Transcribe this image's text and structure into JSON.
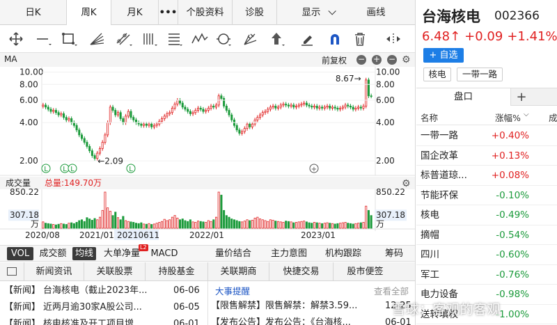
{
  "tabs": [
    {
      "label": "日K"
    },
    {
      "label": "周K"
    },
    {
      "label": "月K"
    },
    {
      "label": "•••"
    },
    {
      "label": "个股资料"
    },
    {
      "label": "诊股"
    },
    {
      "label": "显示"
    },
    {
      "label": "画线"
    }
  ],
  "ma_bar": {
    "label": "MA",
    "adjust": "前复权"
  },
  "volume_bar": {
    "label": "成交量",
    "total": "总量:149.70万"
  },
  "bottom_tabs": [
    "VOL",
    "成交额",
    "均线",
    "大单净量",
    "MACD",
    "量价结合",
    "主力意图",
    "机构跟踪",
    "筹码"
  ],
  "bottom_badge": "L2",
  "news_tabs": [
    "新闻资讯",
    "关联股票",
    "持股基金",
    "关联期商",
    "快捷交易",
    "股市便签"
  ],
  "news": [
    {
      "tag": "【新闻】",
      "title": "台海核电（截止2023年...",
      "date": "06-06"
    },
    {
      "tag": "【新闻】",
      "title": "近两月逾30家A股公司...",
      "date": "06-05"
    },
    {
      "tag": "【新闻】",
      "title": "核电核准及开工项目增...",
      "date": "06-01"
    }
  ],
  "events": {
    "title": "大事提醒",
    "more": "查看全部",
    "items": [
      {
        "tag": "【限售解禁】",
        "title": "限售解禁：解禁3.59...",
        "date": "12-25"
      },
      {
        "tag": "【发布公告】",
        "title": "发布公告：《台海核...",
        "date": "06-01"
      }
    ]
  },
  "stock": {
    "name": "台海核电",
    "code": "002366",
    "price": "6.48",
    "arrow": "↑",
    "change": "+0.09",
    "pct": "+1.41%",
    "add_button": "+ 自选",
    "tags": [
      "核电",
      "一带一路"
    ]
  },
  "panel": {
    "title": "盘口",
    "plus": "+",
    "col_name": "名称",
    "col_pct": "涨幅%",
    "col_extra": "成",
    "rows": [
      {
        "name": "一带一路",
        "pct": "+0.40%",
        "dir": "up"
      },
      {
        "name": "国企改革",
        "pct": "+0.13%",
        "dir": "up"
      },
      {
        "name": "标普道琼...",
        "pct": "+0.08%",
        "dir": "up"
      },
      {
        "name": "节能环保",
        "pct": "-0.10%",
        "dir": "down"
      },
      {
        "name": "核电",
        "pct": "-0.49%",
        "dir": "down"
      },
      {
        "name": "摘帽",
        "pct": "-0.54%",
        "dir": "down"
      },
      {
        "name": "四川",
        "pct": "-0.60%",
        "dir": "down"
      },
      {
        "name": "军工",
        "pct": "-0.76%",
        "dir": "down"
      },
      {
        "name": "电力设备",
        "pct": "-0.98%",
        "dir": "down"
      },
      {
        "name": "送转填权",
        "pct": "-1.00%",
        "dir": "down"
      }
    ]
  },
  "watermark": "雪球：客观的客观",
  "chart_data": {
    "type": "candlestick",
    "price_axis": {
      "scale": "log",
      "ticks_left": [
        "10.00",
        "8.00",
        "6.00",
        "4.00",
        "2.00"
      ],
      "ticks_right": [
        "10.00",
        "8.00",
        "6.00",
        "4.00",
        "2.00"
      ],
      "ylim": [
        1.7,
        10.2
      ]
    },
    "annotations": [
      {
        "label": "←2.09",
        "value": 2.09
      },
      {
        "label": "8.67→",
        "value": 8.67
      }
    ],
    "x_labels": [
      "2020/08",
      "2021/01",
      "20210611",
      "2022/01",
      "2023/01"
    ],
    "volume_axis": {
      "ticks_left": [
        "850.22",
        "307.18",
        "万"
      ],
      "ticks_right": [
        "850.22",
        "307.18",
        "万"
      ],
      "max": 850.22,
      "mid": 307.18
    },
    "markers": [
      "L",
      "L",
      "L",
      "L",
      "+"
    ],
    "weekly_close": [
      5.5,
      5.3,
      5.1,
      4.9,
      5.0,
      4.8,
      4.6,
      4.7,
      4.4,
      4.2,
      4.3,
      4.0,
      3.8,
      3.5,
      3.2,
      3.0,
      2.8,
      2.6,
      2.4,
      2.2,
      2.09,
      2.3,
      2.5,
      2.8,
      3.2,
      4.0,
      5.3,
      5.0,
      4.6,
      4.8,
      4.3,
      4.0,
      4.5,
      4.9,
      4.4,
      4.2,
      4.0,
      3.9,
      3.8,
      3.9,
      3.8,
      3.9,
      3.7,
      3.8,
      3.9,
      4.1,
      4.3,
      4.5,
      4.7,
      4.8,
      5.2,
      5.6,
      6.0,
      5.7,
      5.3,
      5.1,
      4.9,
      4.7,
      4.8,
      5.0,
      5.2,
      5.1,
      4.9,
      5.0,
      5.2,
      5.4,
      5.3,
      5.5,
      6.5,
      6.2,
      5.4,
      5.0,
      4.6,
      4.2,
      3.8,
      3.5,
      3.3,
      3.4,
      3.6,
      3.9,
      3.7,
      3.9,
      4.2,
      4.4,
      4.6,
      4.8,
      4.9,
      5.1,
      5.3,
      5.4,
      5.2,
      5.3,
      5.5,
      5.6,
      5.5,
      5.4,
      5.5,
      5.3,
      5.4,
      5.5,
      5.6,
      5.7,
      5.5,
      5.4,
      5.3,
      5.4,
      5.2,
      5.3,
      5.2,
      5.3,
      5.4,
      5.2,
      5.3,
      5.2,
      5.1,
      5.2,
      5.3,
      5.5,
      5.4,
      5.3,
      5.1,
      5.2,
      5.3,
      5.2,
      5.4,
      8.67,
      6.5,
      6.48
    ],
    "weekly_volume": [
      150,
      120,
      110,
      100,
      90,
      80,
      95,
      110,
      100,
      90,
      120,
      130,
      110,
      140,
      180,
      200,
      160,
      250,
      220,
      190,
      230,
      200,
      260,
      420,
      850,
      480,
      400,
      300,
      380,
      250,
      200,
      280,
      180,
      160,
      150,
      140,
      120,
      110,
      130,
      100,
      95,
      110,
      90,
      100,
      120,
      140,
      160,
      210,
      180,
      200,
      260,
      300,
      240,
      200,
      220,
      180,
      160,
      200,
      150,
      140,
      170,
      160,
      150,
      140,
      180,
      160,
      200,
      260,
      850,
      780,
      420,
      300,
      260,
      220,
      200,
      180,
      160,
      150,
      170,
      200,
      180,
      190,
      240,
      260,
      220,
      200,
      180,
      160,
      200,
      190,
      170,
      160,
      150,
      140,
      170,
      160,
      150,
      130,
      140,
      150,
      160,
      170,
      150,
      130,
      120,
      140,
      130,
      120,
      110,
      120,
      130,
      120,
      110,
      100,
      110,
      120,
      130,
      140,
      120,
      110,
      100,
      110,
      120,
      130,
      140,
      520,
      420,
      300
    ]
  }
}
